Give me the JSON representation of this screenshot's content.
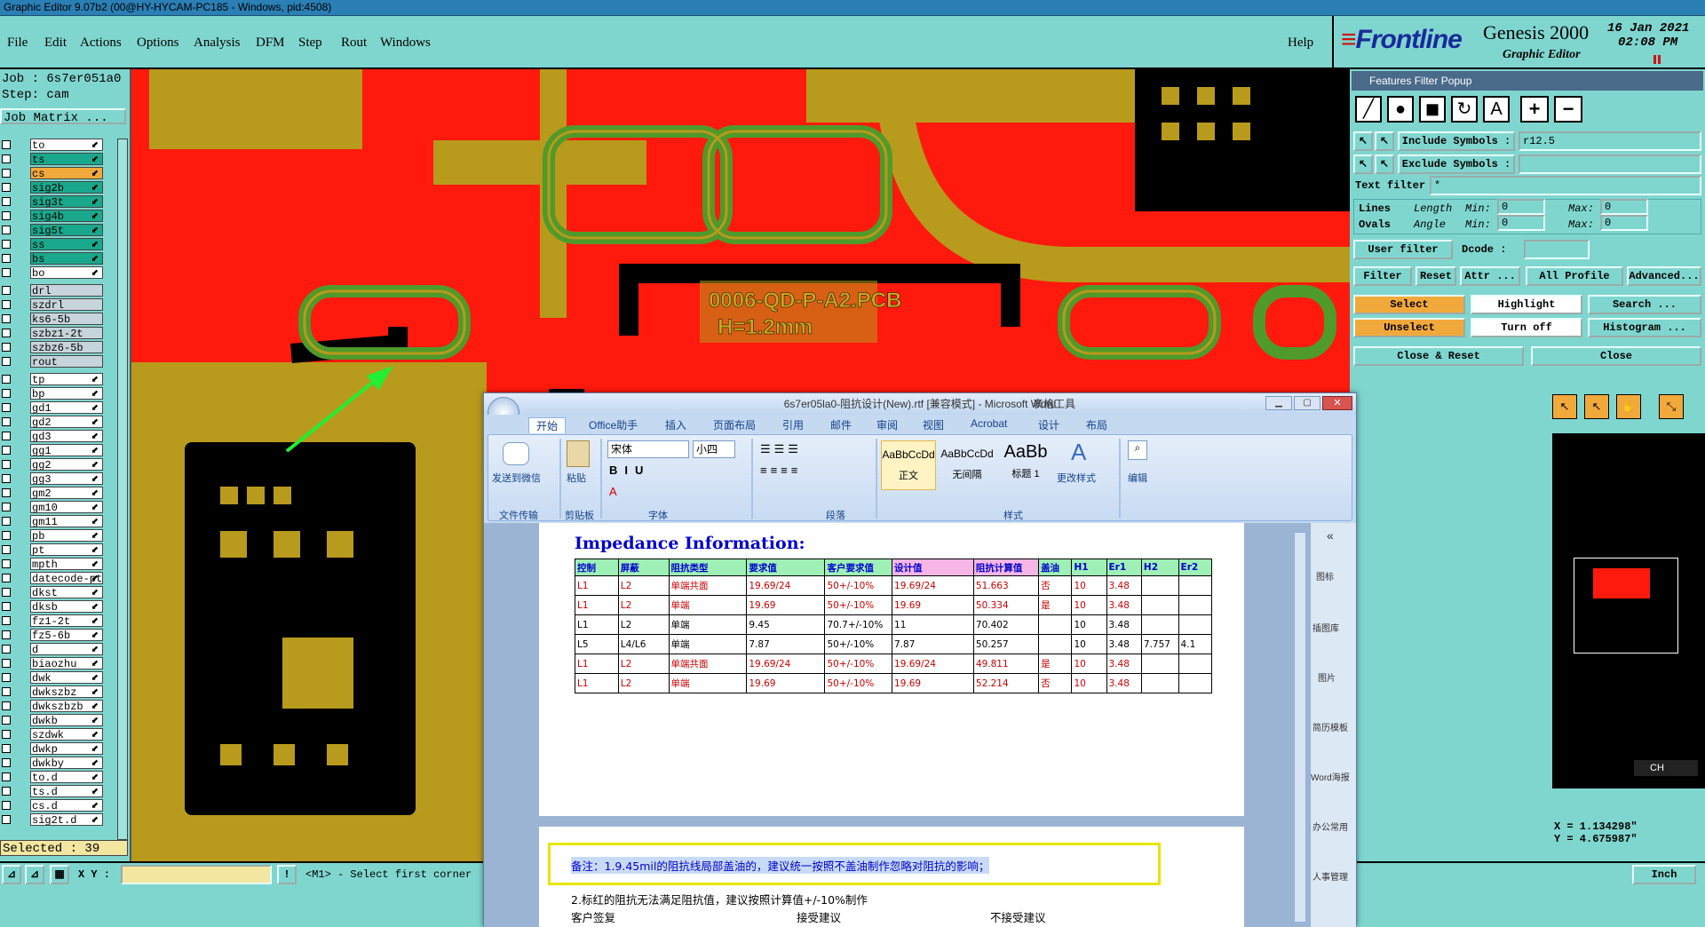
{
  "window_title": "Graphic Editor 9.07b2 (00@HY-HYCAM-PC185 - Windows, pid:4508)",
  "menu": [
    "File",
    "Edit",
    "Actions",
    "Options",
    "Analysis",
    "DFM",
    "Step",
    "Rout",
    "Windows"
  ],
  "help_label": "Help",
  "logo": {
    "brand": "Frontline",
    "product": "Genesis 2000",
    "subtitle": "Graphic Editor",
    "date": "16 Jan 2021",
    "time": "02:08 PM"
  },
  "job": {
    "job_label": "Job : 6s7er051a0",
    "step_label": "Step: cam",
    "matrix_button": "Job Matrix ..."
  },
  "layers_group1": [
    {
      "name": "to",
      "color": "#ffffff"
    },
    {
      "name": "ts",
      "color": "#19a88c"
    },
    {
      "name": "cs",
      "color": "#f2a93b"
    },
    {
      "name": "sig2b",
      "color": "#19a88c"
    },
    {
      "name": "sig3t",
      "color": "#19a88c"
    },
    {
      "name": "sig4b",
      "color": "#19a88c"
    },
    {
      "name": "sig5t",
      "color": "#19a88c"
    },
    {
      "name": "ss",
      "color": "#19a88c"
    },
    {
      "name": "bs",
      "color": "#19a88c"
    },
    {
      "name": "bo",
      "color": "#ffffff"
    }
  ],
  "layers_group2": [
    "drl",
    "szdrl",
    "ks6-5b",
    "szbz1-2t",
    "szbz6-5b",
    "rout"
  ],
  "layers_group3": [
    "tp",
    "bp",
    "gd1",
    "gd2",
    "gd3",
    "gg1",
    "gg2",
    "gg3",
    "gm2",
    "gm10",
    "gm11",
    "pb",
    "pt",
    "mpth",
    "datecode-pt",
    "dkst",
    "dksb",
    "fz1-2t",
    "fz5-6b",
    "d",
    "biaozhu",
    "dwk",
    "dwkszbz",
    "dwkszbzb",
    "dwkb",
    "szdwk",
    "dwkp",
    "dwkby",
    "to.d",
    "ts.d",
    "cs.d",
    "sig2t.d"
  ],
  "selected_label": "Selected : 39",
  "pcb_text": {
    "line1": "0006-QD-P-A2.PCB",
    "line2": "H=1.2mm"
  },
  "filter_popup": {
    "title": "Features Filter Popup",
    "include_label": "Include Symbols :",
    "include_value": "r12.5",
    "exclude_label": "Exclude Symbols :",
    "text_filter_label": "Text filter",
    "text_filter_value": "*",
    "lines_label": "Lines",
    "ovals_label": "Ovals",
    "length_label": "Length",
    "angle_label": "Angle",
    "min_label": "Min:",
    "max_label": "Max:",
    "min_value": "0",
    "max_value": "0",
    "user_filter_label": "User filter ...",
    "dcode_label": "Dcode :",
    "filter_label": "Filter",
    "reset_label": "Reset",
    "attr_label": "Attr ...",
    "all_profile_label": "All Profile",
    "advanced_label": "Advanced...",
    "select_label": "Select",
    "highlight_label": "Highlight",
    "search_label": "Search ...",
    "unselect_label": "Unselect",
    "turnoff_label": "Turn off",
    "histogram_label": "Histogram ...",
    "close_reset_label": "Close & Reset",
    "close_label": "Close"
  },
  "coords": {
    "x": "X = 1.134298\"",
    "y": "Y = 4.675987\""
  },
  "units_label": "Inch",
  "ch_label": "CH",
  "status": {
    "xy_label": "X Y :",
    "prompt": "<M1> - Select first corner"
  },
  "word": {
    "title": "6s7er05la0-阻抗设计(New).rtf [兼容模式] - Microsoft Word",
    "table_tools": "表格工具",
    "tabs": [
      "开始",
      "Office助手",
      "插入",
      "页面布局",
      "引用",
      "邮件",
      "审阅",
      "视图",
      "Acrobat",
      "设计",
      "布局"
    ],
    "ribbon": {
      "wechat": "发送到微信",
      "file_transfer": "文件传输",
      "paste": "粘贴",
      "clipboard": "剪贴板",
      "font_name": "宋体",
      "font_size": "小四",
      "font_group": "字体",
      "paragraph_group": "段落",
      "style1_preview": "AaBbCcDd",
      "style1": "正文",
      "style2_preview": "AaBbCcDd",
      "style2": "无间隔",
      "style3_preview": "AaBb",
      "style3": "标题 1",
      "styles_group": "样式",
      "change_styles": "更改样式",
      "edit": "编辑"
    },
    "heading": "Impedance Information:",
    "table_headers": [
      "控制",
      "屏蔽",
      "阻抗类型",
      "要求值",
      "客户要求值",
      "设计值",
      "阻抗计算值",
      "盖油",
      "H1",
      "Er1",
      "H2",
      "Er2"
    ],
    "table_rows": [
      {
        "cells": [
          "L1",
          "L2",
          "单端共面",
          "19.69/24",
          "50+/-10%",
          "19.69/24",
          "51.663",
          "否",
          "10",
          "3.48",
          "",
          ""
        ],
        "red": true
      },
      {
        "cells": [
          "L1",
          "L2",
          "单端",
          "19.69",
          "50+/-10%",
          "19.69",
          "50.334",
          "是",
          "10",
          "3.48",
          "",
          ""
        ],
        "red": true
      },
      {
        "cells": [
          "L1",
          "L2",
          "单端",
          "9.45",
          "70.7+/-10%",
          "11",
          "70.402",
          "",
          "10",
          "3.48",
          "",
          ""
        ],
        "red": false
      },
      {
        "cells": [
          "L5",
          "L4/L6",
          "单端",
          "7.87",
          "50+/-10%",
          "7.87",
          "50.257",
          "",
          "10",
          "3.48",
          "7.757",
          "4.1"
        ],
        "red": false
      },
      {
        "cells": [
          "L1",
          "L2",
          "单端共面",
          "19.69/24",
          "50+/-10%",
          "19.69/24",
          "49.811",
          "是",
          "10",
          "3.48",
          "",
          ""
        ],
        "red": true
      },
      {
        "cells": [
          "L1",
          "L2",
          "单端",
          "19.69",
          "50+/-10%",
          "19.69",
          "52.214",
          "否",
          "10",
          "3.48",
          "",
          ""
        ],
        "red": true
      }
    ],
    "note1": "备注：1.9.45mil的阻抗线局部盖油的，建议统一按照不盖油制作忽略对阻抗的影响；",
    "note2": "2.标红的阻抗无法满足阻抗值，建议按照计算值+/-10%制作",
    "note3": "客户签复",
    "note4": "接受建议",
    "note5": "不接受建议",
    "side_panel": [
      "图标",
      "插图库",
      "图片",
      "简历模板",
      "Word海报",
      "办公常用",
      "人事管理"
    ]
  }
}
